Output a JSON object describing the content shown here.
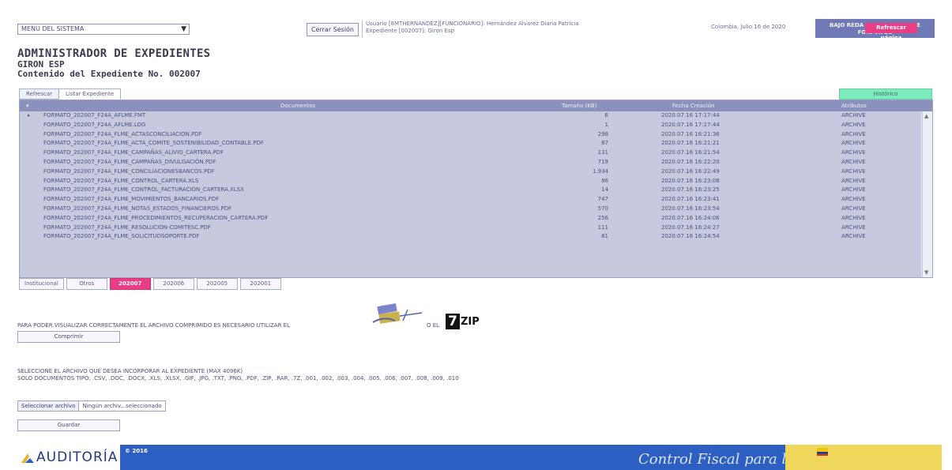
{
  "topbar": {
    "menu_select": "MENU DEL SISTEMA",
    "logout_label": "Cerrar Sesión",
    "user_line1": "Usuario [8MTHERNANDEZ][FUNCIONARIO]: Hernández Alvarez Diana Patricia",
    "user_line2": "Expediente [002007]: Giron Esp",
    "date_text": "Colombia, Julio 16 de 2020",
    "formats_label": "BAJO REDA LA RENDICION DE FORMATOS",
    "refresh_page_label": "Refrescar página"
  },
  "header": {
    "title": "ADMINISTRADOR DE EXPEDIENTES",
    "entity": "GIRON ESP",
    "subtitle": "Contenido del Expediente No. 002007"
  },
  "tabs": {
    "refresh_label": "Refrescar",
    "list_label": "Listar Expediente",
    "history_label": "Histórico"
  },
  "table": {
    "columns": [
      "Documentos",
      "Tamaño (KB)",
      "Fecha Creación",
      "Atributos"
    ],
    "rows": [
      {
        "doc": "FORMATO_202007_F24A_AFLME.FMT",
        "size": "6",
        "date": "2020.07.16 17:17:44",
        "attr": "ARCHIVE"
      },
      {
        "doc": "FORMATO_202007_F24A_AFLME.LOG",
        "size": "1",
        "date": "2020.07.16 17:17:44",
        "attr": "ARCHIVE"
      },
      {
        "doc": "FORMATO_202007_F24A_FLME_ACTASCONCILIACION.PDF",
        "size": "298",
        "date": "2020.07.16 16:21:36",
        "attr": "ARCHIVE"
      },
      {
        "doc": "FORMATO_202007_F24A_FLME_ACTA_COMITE_SOSTENIBILIDAD_CONTABLE.PDF",
        "size": "87",
        "date": "2020.07.16 16:21:21",
        "attr": "ARCHIVE"
      },
      {
        "doc": "FORMATO_202007_F24A_FLME_CAMPAÑAS_ALIVIO_CARTERA.PDF",
        "size": "131",
        "date": "2020.07.16 16:21:54",
        "attr": "ARCHIVE"
      },
      {
        "doc": "FORMATO_202007_F24A_FLME_CAMPAÑAS_DIVULGACIÓN.PDF",
        "size": "719",
        "date": "2020.07.16 16:22:20",
        "attr": "ARCHIVE"
      },
      {
        "doc": "FORMATO_202007_F24A_FLME_CONCILIACIONESBANCOS.PDF",
        "size": "1.934",
        "date": "2020.07.16 16:22:49",
        "attr": "ARCHIVE"
      },
      {
        "doc": "FORMATO_202007_F24A_FLME_CONTROL_CARTERA.XLS",
        "size": "86",
        "date": "2020.07.16 16:23:08",
        "attr": "ARCHIVE"
      },
      {
        "doc": "FORMATO_202007_F24A_FLME_CONTROL_FACTURACION_CARTERA.XLSX",
        "size": "14",
        "date": "2020.07.16 16:23:25",
        "attr": "ARCHIVE"
      },
      {
        "doc": "FORMATO_202007_F24A_FLME_MOVIMIENTOS_BANCARIOS.PDF",
        "size": "747",
        "date": "2020.07.16 16:23:41",
        "attr": "ARCHIVE"
      },
      {
        "doc": "FORMATO_202007_F24A_FLME_NOTAS_ESTADOS_FINANCIEROS.PDF",
        "size": "570",
        "date": "2020.07.16 16:23:54",
        "attr": "ARCHIVE"
      },
      {
        "doc": "FORMATO_202007_F24A_FLME_PROCEDIMIENTOS_RECUPERACION_CARTERA.PDF",
        "size": "256",
        "date": "2020.07.16 16:24:06",
        "attr": "ARCHIVE"
      },
      {
        "doc": "FORMATO_202007_F24A_FLME_RESOLUCION-COMITESC.PDF",
        "size": "111",
        "date": "2020.07.16 16:24:27",
        "attr": "ARCHIVE"
      },
      {
        "doc": "FORMATO_202007_F24A_FLME_SOLICITUDSOPORTE.PDF",
        "size": "81",
        "date": "2020.07.16 16:24:54",
        "attr": "ARCHIVE"
      }
    ]
  },
  "year_tabs": [
    {
      "label": "Institucional",
      "active": false
    },
    {
      "label": "Otros",
      "active": false
    },
    {
      "label": "202007",
      "active": true
    },
    {
      "label": "202006",
      "active": false
    },
    {
      "label": "202005",
      "active": false
    },
    {
      "label": "202001",
      "active": false
    }
  ],
  "compress": {
    "notice": "PARA PODER VISUALIZAR CORRECTAMENTE EL ARCHIVO COMPRIMIDO ES NECESARIO UTILIZAR EL",
    "or_text": "O EL",
    "sevenzip_number": "7",
    "sevenzip_word": "ZIP",
    "compress_label": "Comprimir"
  },
  "upload": {
    "line1": "SELECCIONE EL ARCHIVO QUE DESEA INCORPORAR AL EXPEDIENTE (MAX 4096K)",
    "line2": "SOLO DOCUMENTOS TIPO: .CSV, .DOC, .DOCX, .XLS, .XLSX, .GIF, .JPG, .TXT, .PNG, .PDF, .ZIP, .RAR, .7Z, .001, .002, .003, .004, .005, .006, .007, .008, .009, .010",
    "choose_label": "Seleccionar archivo",
    "no_file_label": "Ningún archiv...seleccionado",
    "save_label": "Guardar"
  },
  "footer": {
    "logo_text": "AUDITORÍA",
    "year": "© 2016",
    "slogan": "Control Fiscal para la PAZ"
  },
  "colors": {
    "header_row": "#8a91bd",
    "row_bg": "#c7cade",
    "accent_pink": "#ea3d86",
    "history_green": "#7eebbc",
    "footer_blue": "#2d5fc3",
    "footer_yellow": "#eed75a"
  }
}
